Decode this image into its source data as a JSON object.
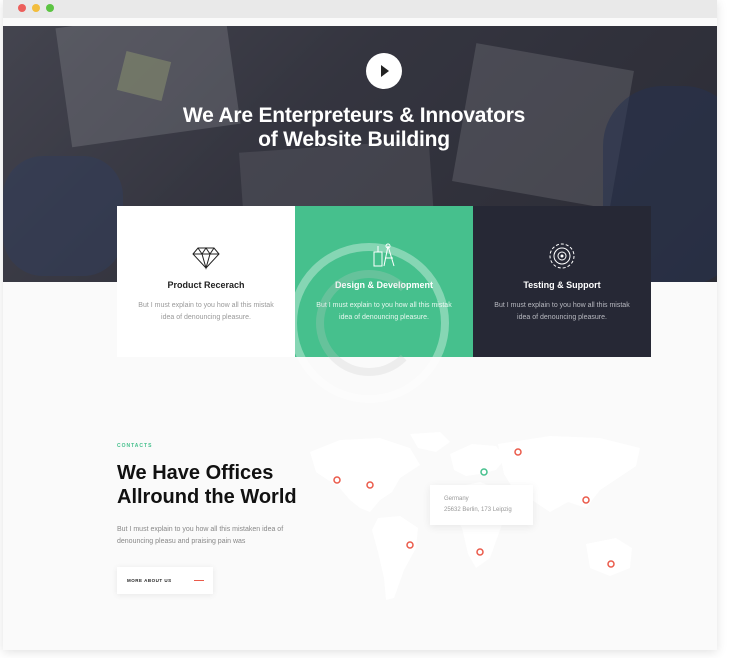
{
  "window": {
    "controls": [
      "close",
      "minimize",
      "maximize"
    ]
  },
  "hero": {
    "play_icon": "play-icon",
    "title_line1": "We Are Enterpreteurs & Innovators",
    "title_line2": "of Website Building"
  },
  "services": [
    {
      "icon": "diamond-icon",
      "title": "Product Recerach",
      "text_line1": "But I must explain to you how all this mistak",
      "text_line2": "idea of denouncing pleasure.",
      "bg": "#ffffff"
    },
    {
      "icon": "design-tools-icon",
      "title": "Design & Development",
      "text_line1": "But I must explain to you how all this mistak",
      "text_line2": "idea of denouncing pleasure.",
      "bg": "#46c08d"
    },
    {
      "icon": "support-rings-icon",
      "title": "Testing & Support",
      "text_line1": "But I must explain to you how all this mistak",
      "text_line2": "idea of denouncing pleasure.",
      "bg": "#262835"
    }
  ],
  "contacts": {
    "label": "CONTACTS",
    "heading_line1": "We Have Offices",
    "heading_line2": "Allround the World",
    "text_line1": "But I must explain to you how all this mistaken idea of",
    "text_line2": "denouncing pleasu and praising pain was",
    "button_label": "MORE ABOUT US"
  },
  "map": {
    "tooltip_line1": "Germany",
    "tooltip_line2": "25632 Berlin, 173 Leipzig"
  },
  "colors": {
    "accent": "#46c08d",
    "dark": "#262835",
    "marker": "#ea5a4a"
  }
}
